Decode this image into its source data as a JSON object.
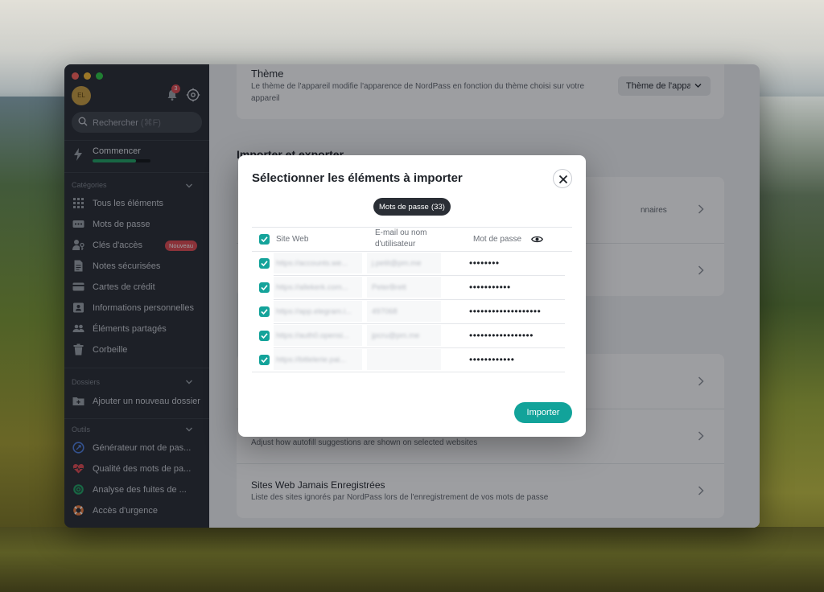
{
  "sidebar": {
    "avatar_initials": "EL",
    "notification_count": "3",
    "search": {
      "placeholder": "Rechercher",
      "shortcut": "(⌘F)"
    },
    "start": {
      "label": "Commencer",
      "progress": 0.75
    },
    "categories": {
      "heading": "Catégories",
      "items": [
        {
          "label": "Tous les éléments",
          "icon": "grid-icon"
        },
        {
          "label": "Mots de passe",
          "icon": "password-icon"
        },
        {
          "label": "Clés d'accès",
          "icon": "passkey-icon",
          "badge": "Nouveau"
        },
        {
          "label": "Notes sécurisées",
          "icon": "note-icon"
        },
        {
          "label": "Cartes de crédit",
          "icon": "credit-card-icon"
        },
        {
          "label": "Informations personnelles",
          "icon": "id-card-icon"
        },
        {
          "label": "Éléments partagés",
          "icon": "shared-users-icon"
        },
        {
          "label": "Corbeille",
          "icon": "trash-icon"
        }
      ]
    },
    "folders": {
      "heading": "Dossiers",
      "add_label": "Ajouter un nouveau dossier"
    },
    "tools": {
      "heading": "Outils",
      "items": [
        {
          "label": "Générateur mot de pas...",
          "icon": "generator-icon"
        },
        {
          "label": "Qualité des mots de pa...",
          "icon": "heart-pulse-icon"
        },
        {
          "label": "Analyse des fuites de ...",
          "icon": "breach-scan-icon"
        },
        {
          "label": "Accès d'urgence",
          "icon": "lifebuoy-icon"
        }
      ]
    }
  },
  "main": {
    "theme": {
      "title": "Thème",
      "description": "Le thème de l'appareil modifie l'apparence de NordPass en fonction du thème choisi sur votre appareil",
      "select_value": "Thème de l'appareil"
    },
    "import_heading": "Importer et exporter",
    "partial_row_text": "nnaires",
    "autofill_desc": "Adjust how autofill suggestions are shown on selected websites",
    "never_saved": {
      "title": "Sites Web Jamais Enregistrées",
      "description": "Liste des sites ignorés par NordPass lors de l'enregistrement de vos mots de passe"
    }
  },
  "modal": {
    "title": "Sélectionner les éléments à importer",
    "chip_label": "Mots de passe",
    "chip_count": "(33)",
    "columns": {
      "site": "Site Web",
      "user": "E-mail ou nom d'utilisateur",
      "password": "Mot de passe"
    },
    "rows": [
      {
        "site": "https://accounts.we...",
        "user": "j.petit@pm.me",
        "password": "••••••••"
      },
      {
        "site": "https://allekerk.com...",
        "user": "PeterBrett",
        "password": "•••••••••••"
      },
      {
        "site": "https://app.elegram.i...",
        "user": "497068",
        "password": "•••••••••••••••••••"
      },
      {
        "site": "https://auth0.opensi...",
        "user": "jpcru@pm.me",
        "password": "•••••••••••••••••"
      },
      {
        "site": "https://bitlelerie.pai...",
        "user": "",
        "password": "••••••••••••"
      }
    ],
    "import_button": "Importer"
  },
  "colors": {
    "accent": "#12a39a",
    "danger": "#e0464d",
    "sidebar_bg": "#23272e"
  }
}
